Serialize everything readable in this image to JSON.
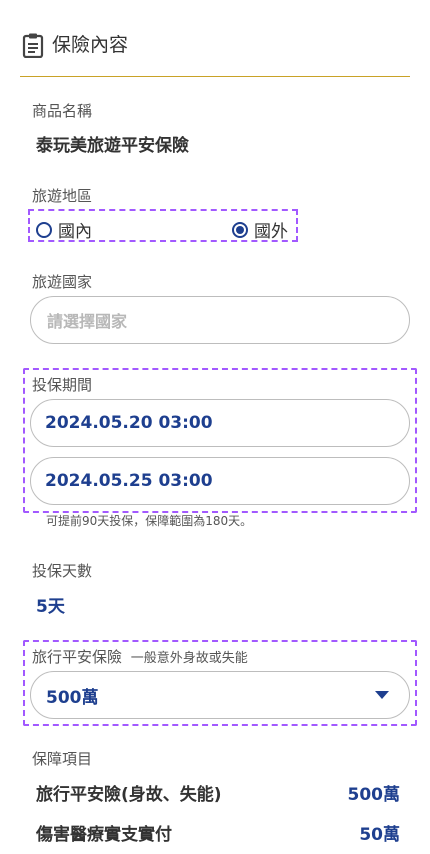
{
  "section": {
    "title": "保險內容",
    "icon": "clipboard-icon"
  },
  "product": {
    "label": "商品名稱",
    "value": "泰玩美旅遊平安保險"
  },
  "region": {
    "label": "旅遊地區",
    "options": [
      {
        "label": "國內",
        "selected": false
      },
      {
        "label": "國外",
        "selected": true
      }
    ]
  },
  "country": {
    "label": "旅遊國家",
    "placeholder": "請選擇國家"
  },
  "period": {
    "label": "投保期間",
    "start": "2024.05.20 03:00",
    "end": "2024.05.25 03:00",
    "note": "可提前90天投保，保障範圍為180天。"
  },
  "days": {
    "label": "投保天數",
    "value": "5天"
  },
  "coverage_amount": {
    "label": "旅行平安保險",
    "sublabel": "一般意外身故或失能",
    "selected": "500萬"
  },
  "coverage_items": {
    "label": "保障項目",
    "items": [
      {
        "name": "旅行平安險(身故、失能)",
        "amount": "500萬"
      },
      {
        "name": "傷害醫療實支實付",
        "amount": "50萬"
      }
    ]
  },
  "colors": {
    "accent": "#1e3f8f",
    "divider": "#c9a227",
    "highlight": "#a259ff"
  }
}
